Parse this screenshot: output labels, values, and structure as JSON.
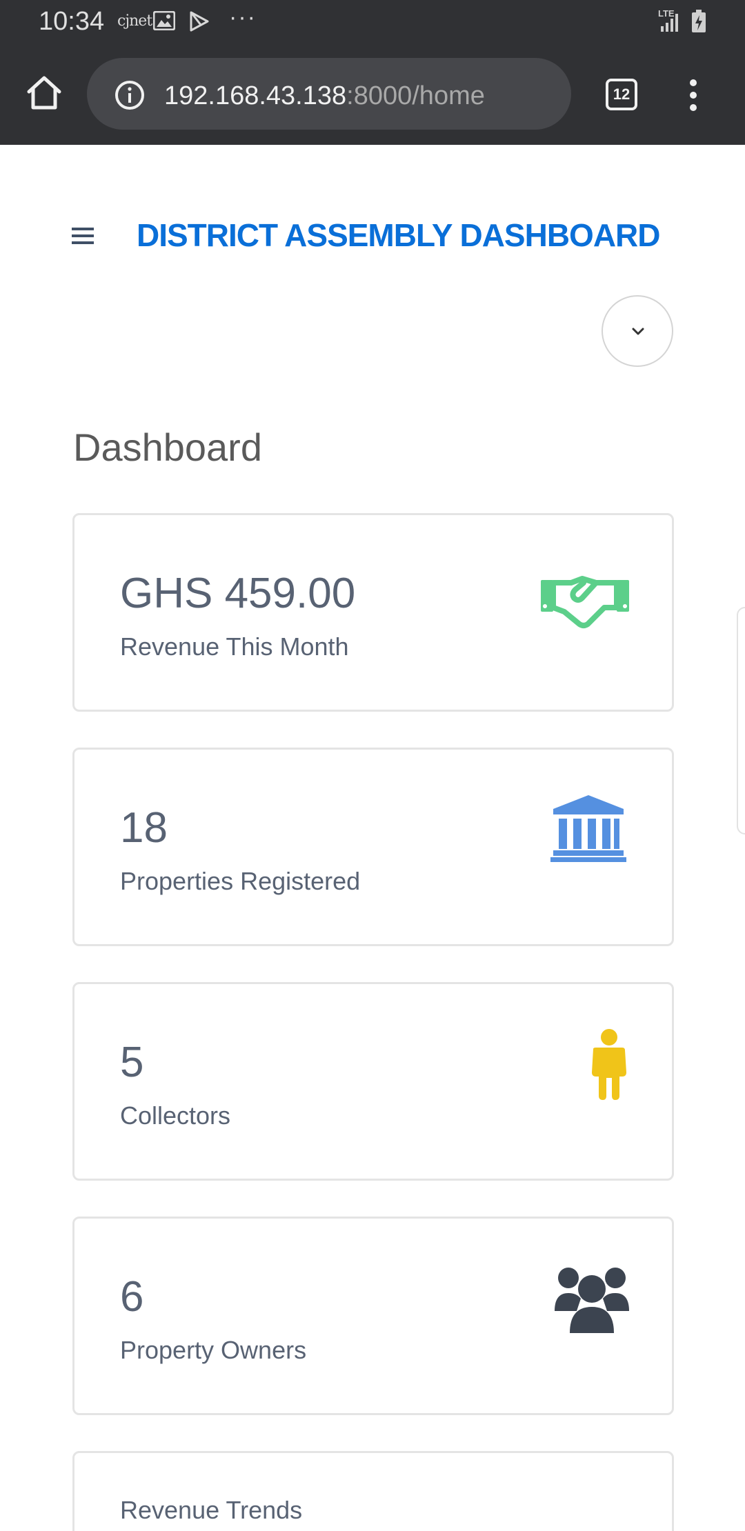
{
  "status_bar": {
    "time": "10:34",
    "notification_label": "cjnet",
    "more": "···",
    "network": "LTE"
  },
  "browser": {
    "url_host": "192.168.43.138",
    "url_rest": ":8000/home",
    "tab_count": "12"
  },
  "app": {
    "title": "DISTRICT ASSEMBLY DASHBOARD",
    "accent_color": "#0a6fd8"
  },
  "page": {
    "heading": "Dashboard"
  },
  "cards": [
    {
      "value": "GHS 459.00",
      "label": "Revenue This Month",
      "icon": "handshake-icon",
      "icon_color": "#5ccf8a"
    },
    {
      "value": "18",
      "label": "Properties Registered",
      "icon": "bank-icon",
      "icon_color": "#5590e0"
    },
    {
      "value": "5",
      "label": "Collectors",
      "icon": "person-icon",
      "icon_color": "#f0c419"
    },
    {
      "value": "6",
      "label": "Property Owners",
      "icon": "users-icon",
      "icon_color": "#3c4450"
    }
  ],
  "trends_card": {
    "title": "Revenue Trends"
  }
}
